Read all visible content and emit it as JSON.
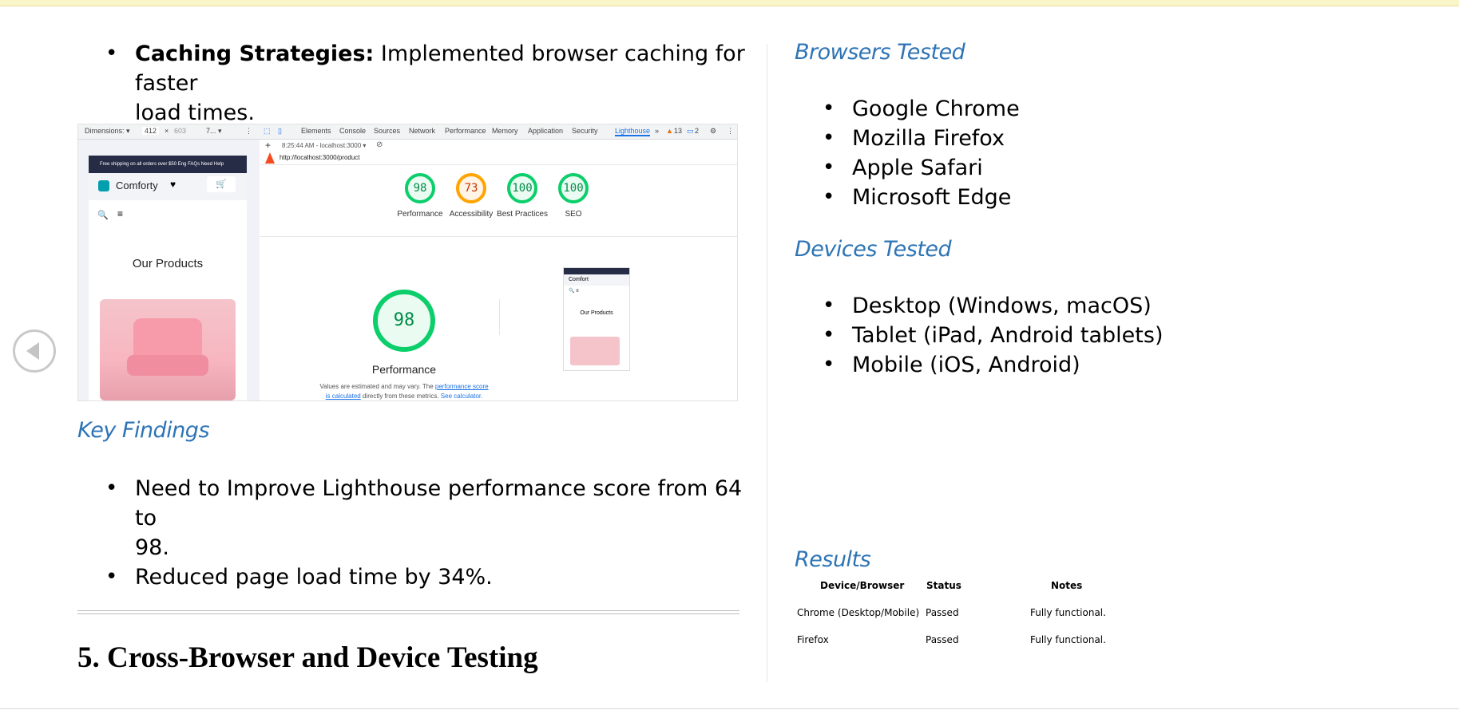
{
  "left": {
    "caching_bold": "Caching Strategies:",
    "caching_line1": " Implemented browser caching for faster",
    "caching_line2": "load times.",
    "key_findings_heading": "Key Findings",
    "findings_1_line1": "Need to Improve Lighthouse performance score from 64 to",
    "findings_1_line2": "98.",
    "findings_2": "Reduced page load time by 34%.",
    "section_heading": "5. Cross-Browser and Device Testing"
  },
  "screenshot": {
    "toolbar": {
      "dimensions": "Dimensions: ▾",
      "width": "412",
      "x": "×",
      "height": "603",
      "zoom": "7... ▾",
      "tabs": [
        "Elements",
        "Console",
        "Sources",
        "Network",
        "Performance",
        "Memory",
        "Application",
        "Security",
        "Lighthouse"
      ],
      "warnings": "13",
      "messages": "2"
    },
    "timestamp": "8:25:44 AM - localhost:3000 ▾",
    "url": "http://localhost:3000/product",
    "mobile": {
      "banner": "Free shipping on all orders over $50   Eng   FAQs   Need Help",
      "brand": "Comforty",
      "heading": "Our Products",
      "mini_brand": "Comfort",
      "mini_heading": "Our Products"
    },
    "scores": [
      {
        "value": "98",
        "label": "Performance",
        "color": "green"
      },
      {
        "value": "73",
        "label": "Accessibility",
        "color": "orange"
      },
      {
        "value": "100",
        "label": "Best Practices",
        "color": "green"
      },
      {
        "value": "100",
        "label": "SEO",
        "color": "green"
      }
    ],
    "big_score": "98",
    "big_label": "Performance",
    "note_1": "Values are estimated and may vary. The ",
    "note_link_1": "performance score",
    "note_link_2": "is calculated",
    "note_2": " directly from these metrics. ",
    "note_link_3": "See calculator."
  },
  "right": {
    "browsers_heading": "Browsers Tested",
    "browsers": [
      "Google Chrome",
      "Mozilla Firefox",
      "Apple Safari",
      "Microsoft Edge"
    ],
    "devices_heading": "Devices Tested",
    "devices": [
      "Desktop (Windows, macOS)",
      "Tablet (iPad, Android tablets)",
      "Mobile (iOS, Android)"
    ],
    "results_heading": "Results",
    "table": {
      "headers": [
        "Device/Browser",
        "Status",
        "Notes"
      ],
      "rows": [
        [
          "Chrome (Desktop/Mobile)",
          "Passed",
          "Fully functional."
        ],
        [
          "Firefox",
          "Passed",
          "Fully functional."
        ]
      ]
    }
  },
  "colors": {
    "heading_blue": "#2e74b5",
    "score_green": "#0cce6b",
    "score_orange": "#ffa400"
  }
}
